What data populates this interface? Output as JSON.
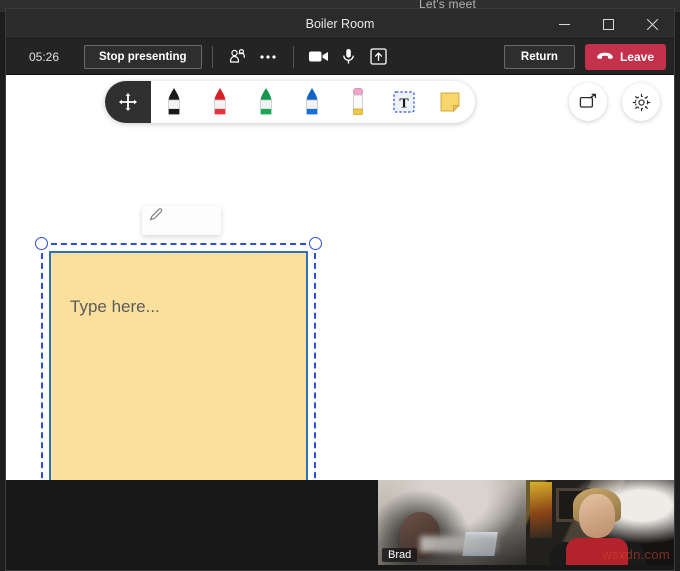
{
  "background": {
    "behind_window_title": "Let's meet"
  },
  "window": {
    "title": "Boiler Room",
    "controls": {
      "minimize": "minimize-icon",
      "maximize": "maximize-icon",
      "close": "close-icon"
    }
  },
  "meeting_controls": {
    "timer": "05:26",
    "stop_presenting_label": "Stop presenting",
    "people_icon": "people-icon",
    "more_icon": "more-options-icon",
    "camera_icon": "camera-icon",
    "microphone_icon": "microphone-icon",
    "share_icon": "share-screen-icon",
    "return_label": "Return",
    "leave_label": "Leave",
    "leave_icon": "hangup-icon",
    "leave_color": "#c4314b"
  },
  "whiteboard": {
    "toolbar": [
      {
        "name": "move-tool",
        "label": "Move",
        "selected": true,
        "color": "#303030"
      },
      {
        "name": "pen-black",
        "label": "Black pen",
        "selected": false,
        "color": "#1a1a1a"
      },
      {
        "name": "pen-red",
        "label": "Red pen",
        "selected": false,
        "color": "#d81f28"
      },
      {
        "name": "pen-green",
        "label": "Green pen",
        "selected": false,
        "color": "#12974c"
      },
      {
        "name": "pen-blue",
        "label": "Blue pen",
        "selected": false,
        "color": "#1263c6"
      },
      {
        "name": "eraser-tool",
        "label": "Eraser",
        "selected": false,
        "color": "#f0a6c8"
      },
      {
        "name": "text-tool",
        "label": "Text",
        "selected": false,
        "color": "#2b4fd8"
      },
      {
        "name": "note-tool",
        "label": "Sticky note",
        "selected": false,
        "color": "#f7d76a"
      }
    ],
    "popout_icon": "popout-icon",
    "settings_icon": "gear-icon",
    "sticky_note": {
      "placeholder": "Type here...",
      "fill_color": "#fae09c",
      "border_color": "#2f6fbf",
      "selection_color": "#2b4fd8",
      "selected": true
    }
  },
  "video_strip": {
    "tiles": [
      {
        "name": "Brad",
        "show_name": true
      },
      {
        "name": "",
        "show_name": false
      }
    ],
    "watermark": "wsxdn.com"
  }
}
